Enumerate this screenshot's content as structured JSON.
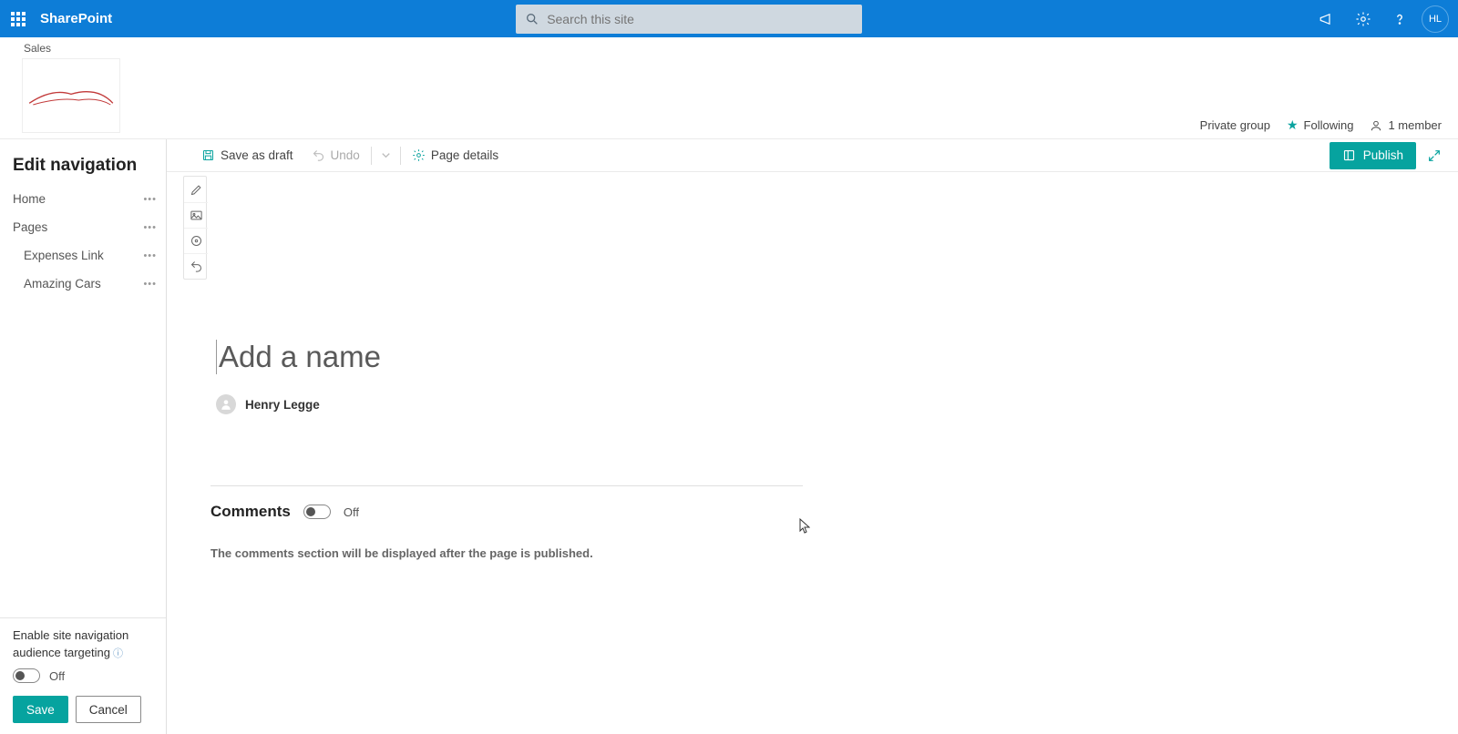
{
  "app": {
    "name": "SharePoint"
  },
  "search": {
    "placeholder": "Search this site"
  },
  "avatar_initials": "HL",
  "site": {
    "name": "Sales",
    "privacy": "Private group",
    "following_label": "Following",
    "member_count": "1 member"
  },
  "sidebar": {
    "title": "Edit navigation",
    "items": [
      {
        "label": "Home",
        "sub": false
      },
      {
        "label": "Pages",
        "sub": false
      },
      {
        "label": "Expenses Link",
        "sub": true
      },
      {
        "label": "Amazing Cars",
        "sub": true
      }
    ],
    "audience_label": "Enable site navigation audience targeting",
    "audience_state": "Off",
    "save_label": "Save",
    "cancel_label": "Cancel"
  },
  "cmdbar": {
    "save_draft": "Save as draft",
    "undo": "Undo",
    "page_details": "Page details",
    "publish": "Publish"
  },
  "page": {
    "title_placeholder": "Add a name",
    "author": "Henry Legge",
    "comments_label": "Comments",
    "comments_state": "Off",
    "comments_note": "The comments section will be displayed after the page is published."
  }
}
